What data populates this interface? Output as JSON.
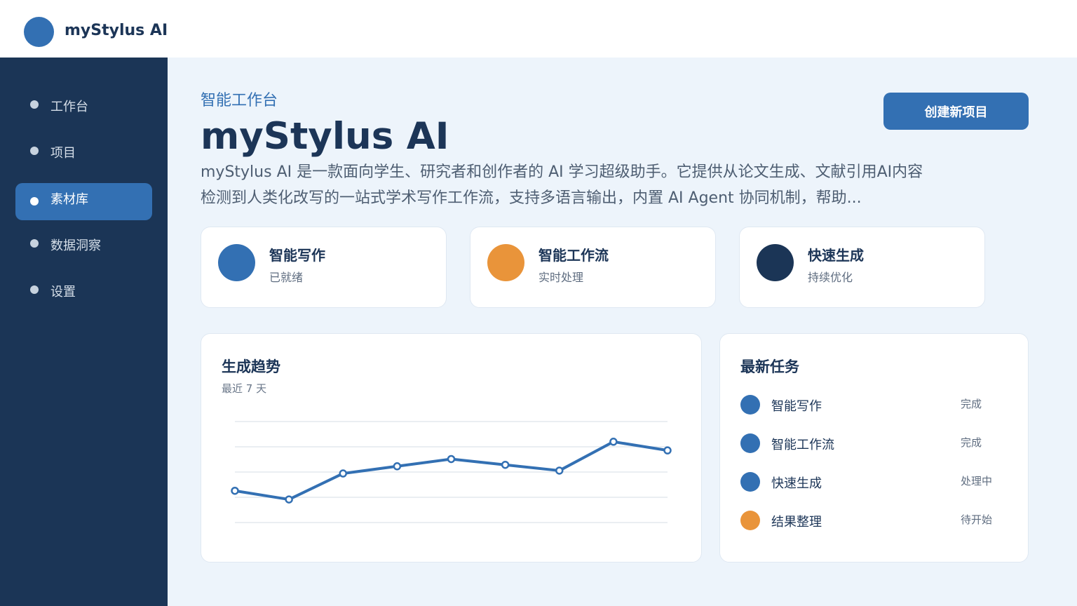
{
  "app": {
    "brand": "myStylus AI"
  },
  "sidebar": {
    "items": [
      {
        "label": "工作台",
        "active": false
      },
      {
        "label": "项目",
        "active": false
      },
      {
        "label": "素材库",
        "active": true
      },
      {
        "label": "数据洞察",
        "active": false
      },
      {
        "label": "设置",
        "active": false
      }
    ]
  },
  "hero": {
    "eyebrow": "智能工作台",
    "title": "myStylus AI",
    "description": "myStylus AI 是一款面向学生、研究者和创作者的 AI 学习超级助手。它提供从论文生成、文献引用AI内容检测到人类化改写的一站式学术写作工作流，支持多语言输出，内置 AI Agent 协同机制，帮助...",
    "create_button": "创建新项目"
  },
  "stats": [
    {
      "title": "智能写作",
      "subtitle": "已就绪",
      "color": "#3370b3"
    },
    {
      "title": "智能工作流",
      "subtitle": "实时处理",
      "color": "#e9943a"
    },
    {
      "title": "快速生成",
      "subtitle": "持续优化",
      "color": "#1b3556"
    }
  ],
  "trend": {
    "title": "生成趋势",
    "subtitle": "最近 7 天"
  },
  "chart_data": {
    "type": "line",
    "x": [
      1,
      2,
      3,
      4,
      5,
      6,
      7,
      8,
      9
    ],
    "series": [
      {
        "values": [
          22,
          16,
          34,
          39,
          44,
          40,
          36,
          56,
          50
        ]
      }
    ],
    "ylim": [
      0,
      70
    ],
    "grid": true,
    "color": "#3370b3"
  },
  "tasks": {
    "title": "最新任务",
    "items": [
      {
        "name": "智能写作",
        "status": "完成",
        "color": "#3370b3"
      },
      {
        "name": "智能工作流",
        "status": "完成",
        "color": "#3370b3"
      },
      {
        "name": "快速生成",
        "status": "处理中",
        "color": "#3370b3"
      },
      {
        "name": "结果整理",
        "status": "待开始",
        "color": "#e9943a"
      }
    ]
  }
}
